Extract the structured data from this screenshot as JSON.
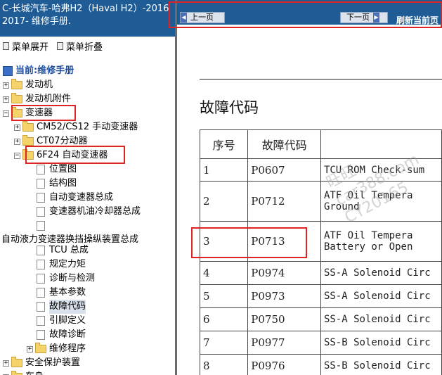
{
  "window": {
    "title_line1": "C-长城汽车-哈弗H2（Haval H2）-2016",
    "title_line2": "2017- 维修手册."
  },
  "menubar": {
    "expand_label": "菜单展开",
    "collapse_label": "菜单折叠"
  },
  "tree": {
    "current_label": "当前:维修手册",
    "items": [
      {
        "label": "发动机"
      },
      {
        "label": "发动机附件"
      },
      {
        "label": "变速器"
      },
      {
        "label": "CM52/CS12 手动变速器"
      },
      {
        "label": "CT07分动器"
      },
      {
        "label": "6F24 自动变速器"
      },
      {
        "label": "位置图"
      },
      {
        "label": "结构图"
      },
      {
        "label": "自动变速器总成"
      },
      {
        "label": "变速器机油冷却器总成"
      },
      {
        "label": ""
      },
      {
        "label": "自动液力变速器换挡操纵装置总成"
      },
      {
        "label": "TCU 总成"
      },
      {
        "label": "规定力矩"
      },
      {
        "label": "诊断与检测"
      },
      {
        "label": "基本参数"
      },
      {
        "label": "故障代码"
      },
      {
        "label": "引脚定义"
      },
      {
        "label": "故障诊断"
      },
      {
        "label": "维修程序"
      },
      {
        "label": "安全保护装置"
      },
      {
        "label": "车身"
      }
    ]
  },
  "nav": {
    "prev_label": "上一页",
    "next_label": "下一页",
    "refresh_label": "刷新当前页"
  },
  "doc": {
    "title": "故障代码",
    "headers": [
      "序号",
      "故障代码",
      ""
    ],
    "rows": [
      {
        "no": "1",
        "code": "P0607",
        "desc1": "TCU ROM Check-sum",
        "desc2": ""
      },
      {
        "no": "2",
        "code": "P0712",
        "desc1": "ATF Oil Tempera",
        "desc2": "Ground"
      },
      {
        "no": "3",
        "code": "P0713",
        "desc1": "ATF Oil Tempera",
        "desc2": "Battery or Open"
      },
      {
        "no": "4",
        "code": "P0974",
        "desc1": "SS-A Solenoid Circ",
        "desc2": ""
      },
      {
        "no": "5",
        "code": "P0973",
        "desc1": "SS-A Solenoid Circ",
        "desc2": ""
      },
      {
        "no": "6",
        "code": "P0750",
        "desc1": "SS-A Solenoid Circ",
        "desc2": ""
      },
      {
        "no": "7",
        "code": "P0977",
        "desc1": "SS-B Solenoid Circ",
        "desc2": ""
      },
      {
        "no": "8",
        "code": "P0976",
        "desc1": "SS-B Solenoid Circ",
        "desc2": ""
      }
    ]
  },
  "watermark": {
    "line1": "旺旺",
    "line2": "car388.com",
    "line3": "CY20165"
  },
  "colors": {
    "titlebar": "#1f5c96",
    "annotation_red": "#e02424",
    "folder_yellow": "#f5d36b"
  }
}
